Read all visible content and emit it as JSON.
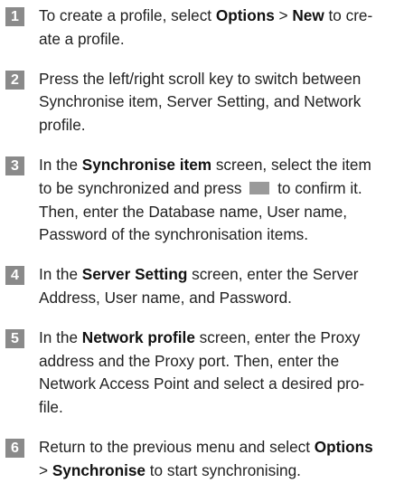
{
  "steps": [
    {
      "number": "1",
      "segments": [
        {
          "t": "To create a profile, select "
        },
        {
          "t": "Options",
          "b": true
        },
        {
          "t": " > "
        },
        {
          "t": "New",
          "b": true
        },
        {
          "t": " to cre-"
        },
        {
          "br": true
        },
        {
          "t": "ate a profile."
        }
      ]
    },
    {
      "number": "2",
      "segments": [
        {
          "t": "Press the left/right scroll key to switch between"
        },
        {
          "br": true
        },
        {
          "t": "Synchronise item, Server Setting, and Network"
        },
        {
          "br": true
        },
        {
          "t": "profile."
        }
      ]
    },
    {
      "number": "3",
      "segments": [
        {
          "t": "In the "
        },
        {
          "t": "Synchronise item",
          "b": true
        },
        {
          "t": " screen, select the item"
        },
        {
          "br": true
        },
        {
          "t": "to be synchronized and press "
        },
        {
          "icon": "confirm-key-icon"
        },
        {
          "t": " to confirm it."
        },
        {
          "br": true
        },
        {
          "t": "Then, enter the Database name, User name,"
        },
        {
          "br": true
        },
        {
          "t": "Password of the synchronisation items."
        }
      ]
    },
    {
      "number": "4",
      "segments": [
        {
          "t": "In the "
        },
        {
          "t": "Server Setting",
          "b": true
        },
        {
          "t": " screen, enter the Server"
        },
        {
          "br": true
        },
        {
          "t": "Address, User name, and Password."
        }
      ]
    },
    {
      "number": "5",
      "segments": [
        {
          "t": "In the "
        },
        {
          "t": "Network profile",
          "b": true
        },
        {
          "t": " screen, enter the Proxy"
        },
        {
          "br": true
        },
        {
          "t": "address and the Proxy port. Then, enter the"
        },
        {
          "br": true
        },
        {
          "t": "Network Access Point  and select a desired pro-"
        },
        {
          "br": true
        },
        {
          "t": "file."
        }
      ]
    },
    {
      "number": "6",
      "segments": [
        {
          "t": "Return to the previous menu and select "
        },
        {
          "t": "Options",
          "b": true
        },
        {
          "br": true
        },
        {
          "t": "> "
        },
        {
          "t": "Synchronise",
          "b": true
        },
        {
          "t": " to start synchronising."
        }
      ]
    }
  ]
}
